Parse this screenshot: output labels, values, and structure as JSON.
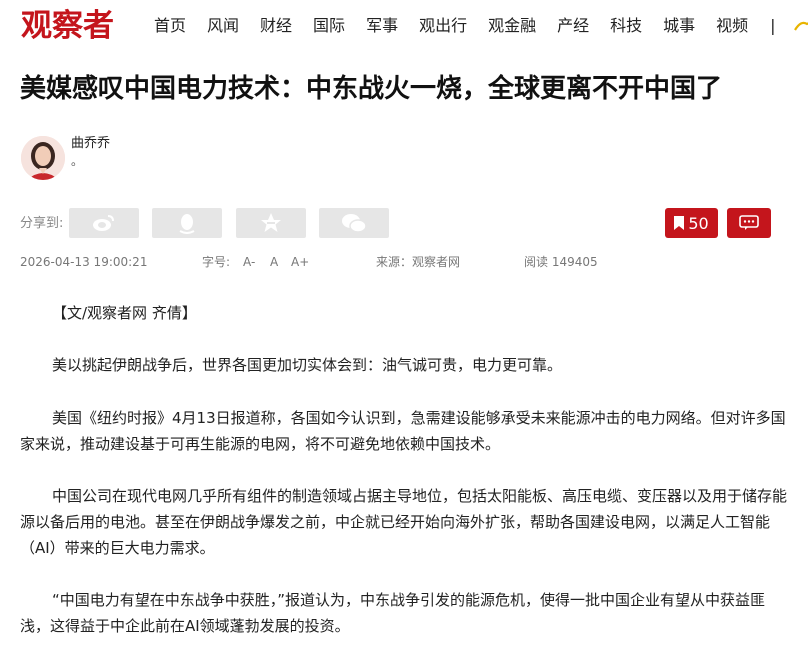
{
  "header": {
    "logo": "观察者",
    "nav": [
      "首页",
      "风闻",
      "财经",
      "国际",
      "军事",
      "观出行",
      "观金融",
      "产经",
      "科技",
      "城事",
      "视频"
    ],
    "nav_separator": "|"
  },
  "article": {
    "title": "美媒感叹中国电力技术：中东战火一烧，全球更离不开中国了",
    "author": {
      "name": "曲乔乔",
      "bio": "。"
    },
    "share_label": "分享到:",
    "share_buttons": [
      "weibo-icon",
      "qq-icon",
      "qzone-icon",
      "wechat-icon"
    ],
    "favorite_count": "50",
    "meta": {
      "datetime": "2026-04-13 19:00:21",
      "font_size_label": "字号:",
      "font_small": "A-",
      "font_normal": "A",
      "font_large": "A+",
      "source": "来源：观察者网",
      "reads": "阅读 149405"
    },
    "paragraphs": [
      "【文/观察者网 齐倩】",
      "美以挑起伊朗战争后，世界各国更加切实体会到：油气诚可贵，电力更可靠。",
      "美国《纽约时报》4月13日报道称，各国如今认识到，急需建设能够承受未来能源冲击的电力网络。但对许多国家来说，推动建设基于可再生能源的电网，将不可避免地依赖中国技术。",
      "中国公司在现代电网几乎所有组件的制造领域占据主导地位，包括太阳能板、高压电缆、变压器以及用于储存能源以备后用的电池。甚至在伊朗战争爆发之前，中企就已经开始向海外扩张，帮助各国建设电网，以满足人工智能（AI）带来的巨大电力需求。",
      "“中国电力有望在中东战争中获胜，”报道认为，中东战争引发的能源危机，使得一批中国企业有望从中获益匪浅，这得益于中企此前在AI领域蓬勃发展的投资。"
    ]
  },
  "colors": {
    "brand": "#c4151c",
    "share_bg": "#e6e6e6"
  }
}
